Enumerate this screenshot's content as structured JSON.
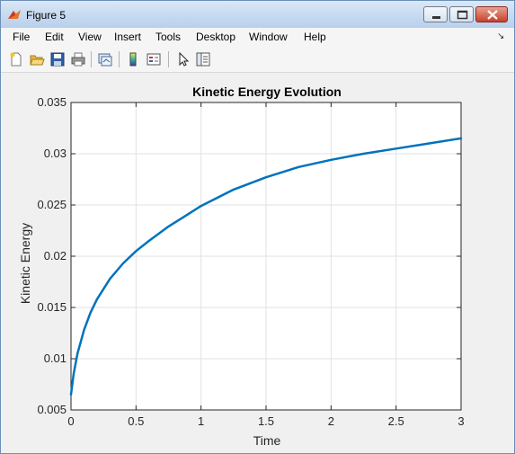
{
  "window": {
    "title": "Figure 5",
    "icon": "matlab-icon"
  },
  "window_controls": {
    "minimize": "minimize-icon",
    "maximize": "maximize-icon",
    "close": "close-icon"
  },
  "menubar": {
    "items": [
      "File",
      "Edit",
      "View",
      "Insert",
      "Tools",
      "Desktop",
      "Window",
      "Help"
    ],
    "dock_icon": "dock-arrow-icon"
  },
  "toolbar": {
    "buttons": [
      "new-figure-icon",
      "open-file-icon",
      "save-icon",
      "print-icon",
      "link-plot-icon",
      "colorbar-icon",
      "legend-icon",
      "pointer-icon",
      "property-inspector-icon"
    ]
  },
  "chart_data": {
    "type": "line",
    "title": "Kinetic Energy Evolution",
    "xlabel": "Time",
    "ylabel": "Kinetic Energy",
    "xlim": [
      0,
      3
    ],
    "ylim": [
      0.005,
      0.035
    ],
    "xticks": [
      "0",
      "0.5",
      "1",
      "1.5",
      "2",
      "2.5",
      "3"
    ],
    "yticks": [
      "0.005",
      "0.01",
      "0.015",
      "0.02",
      "0.025",
      "0.03",
      "0.035"
    ],
    "grid": true,
    "line_color": "#0072bd",
    "series": [
      {
        "x": [
          0,
          0.02,
          0.05,
          0.1,
          0.15,
          0.2,
          0.3,
          0.4,
          0.5,
          0.6,
          0.75,
          0.9,
          1.0,
          1.25,
          1.5,
          1.75,
          2.0,
          2.25,
          2.5,
          2.75,
          3.0
        ],
        "y": [
          0.0065,
          0.0085,
          0.0105,
          0.0128,
          0.0145,
          0.0158,
          0.0178,
          0.0193,
          0.0205,
          0.0215,
          0.0229,
          0.0241,
          0.0249,
          0.0265,
          0.0277,
          0.0287,
          0.0294,
          0.03,
          0.0305,
          0.031,
          0.0315
        ]
      }
    ]
  }
}
